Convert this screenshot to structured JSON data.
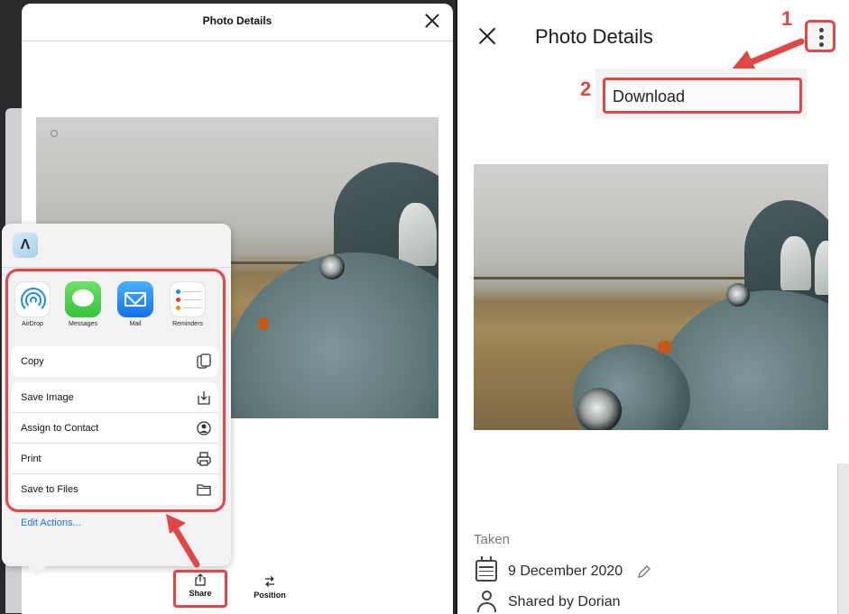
{
  "ios": {
    "header_title": "Photo Details",
    "share_sheet": {
      "app_badge_letter": "Λ",
      "apps": [
        {
          "label": "AirDrop",
          "icon": "airdrop-icon"
        },
        {
          "label": "Messages",
          "icon": "messages-icon"
        },
        {
          "label": "Mail",
          "icon": "mail-icon"
        },
        {
          "label": "Reminders",
          "icon": "reminders-icon"
        }
      ],
      "copy": {
        "label": "Copy",
        "icon": "copy-icon"
      },
      "actions": [
        {
          "label": "Save Image",
          "icon": "save-image-icon"
        },
        {
          "label": "Assign to Contact",
          "icon": "contact-icon"
        },
        {
          "label": "Print",
          "icon": "printer-icon"
        },
        {
          "label": "Save to Files",
          "icon": "folder-icon"
        }
      ],
      "edit_actions": "Edit Actions..."
    },
    "toolbar": {
      "share_label": "Share",
      "position_label": "Position"
    }
  },
  "android": {
    "header_title": "Photo Details",
    "menu": {
      "download_label": "Download"
    },
    "details": {
      "section_label": "Taken",
      "date": "9 December 2020",
      "shared_by": "Shared by Dorian"
    }
  },
  "annotations": {
    "step_1": "1",
    "step_2": "2",
    "highlight_color": "#e04848"
  }
}
